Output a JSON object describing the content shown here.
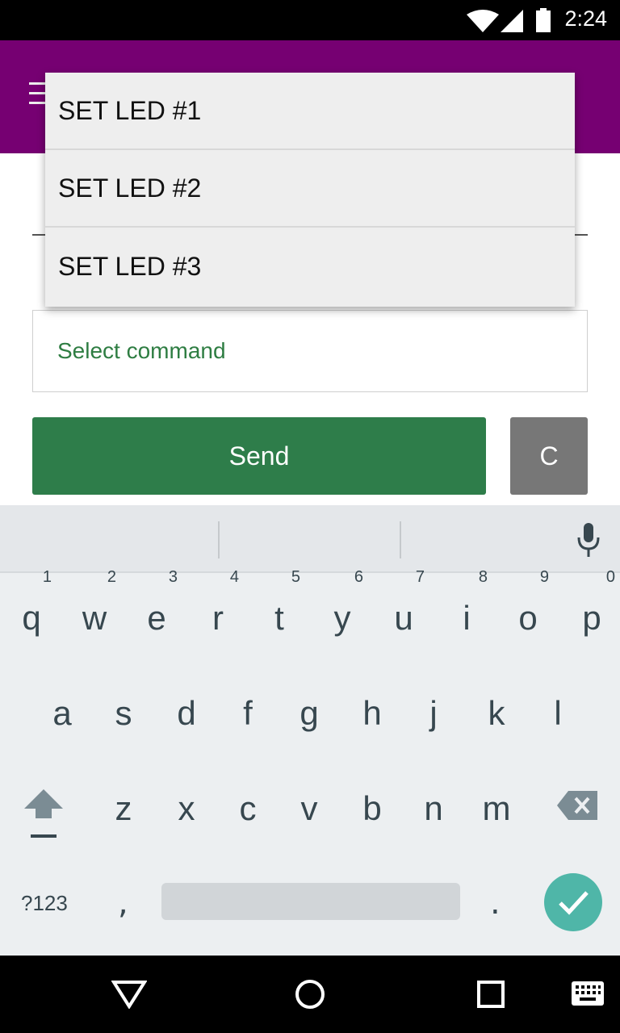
{
  "status": {
    "time": "2:24"
  },
  "dropdown": {
    "items": [
      "SET LED #1",
      "SET LED #2",
      "SET LED #3"
    ]
  },
  "form": {
    "command_label": "Select command",
    "send_label": "Send",
    "clear_label": "C"
  },
  "keyboard": {
    "row1": [
      {
        "letter": "q",
        "num": "1"
      },
      {
        "letter": "w",
        "num": "2"
      },
      {
        "letter": "e",
        "num": "3"
      },
      {
        "letter": "r",
        "num": "4"
      },
      {
        "letter": "t",
        "num": "5"
      },
      {
        "letter": "y",
        "num": "6"
      },
      {
        "letter": "u",
        "num": "7"
      },
      {
        "letter": "i",
        "num": "8"
      },
      {
        "letter": "o",
        "num": "9"
      },
      {
        "letter": "p",
        "num": "0"
      }
    ],
    "row2": [
      "a",
      "s",
      "d",
      "f",
      "g",
      "h",
      "j",
      "k",
      "l"
    ],
    "row3": [
      "z",
      "x",
      "c",
      "v",
      "b",
      "n",
      "m"
    ],
    "symbols_label": "?123",
    "comma": ",",
    "period": "."
  },
  "colors": {
    "app_bar": "#760072",
    "accent_green": "#2e7d4a",
    "done_key": "#4fb6a8"
  }
}
